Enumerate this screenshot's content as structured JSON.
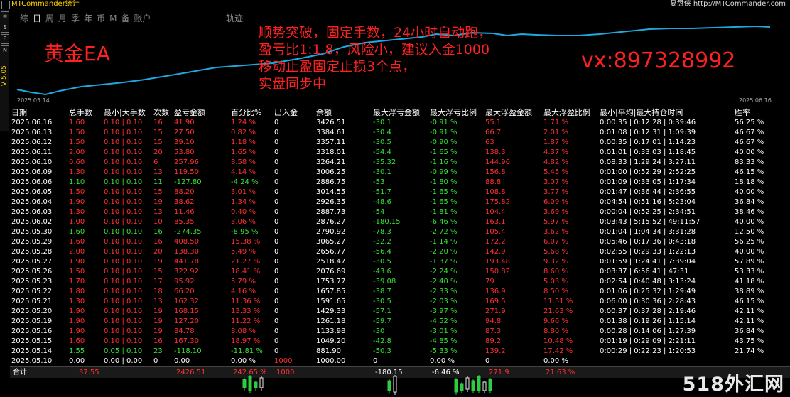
{
  "titlebar": {
    "title": "MTCommander统计",
    "right": "复盘侠 http://MTCommander.com"
  },
  "left_buttons": [
    "≡",
    "S",
    "E",
    "N"
  ],
  "version": "V 5.05",
  "tabs": [
    {
      "label": "综",
      "active": false
    },
    {
      "label": "日",
      "active": true
    },
    {
      "label": "周",
      "active": false
    },
    {
      "label": "月",
      "active": false
    },
    {
      "label": "季",
      "active": false
    },
    {
      "label": "年",
      "active": false
    },
    {
      "label": "币",
      "active": false
    },
    {
      "label": "M",
      "active": false
    },
    {
      "label": "备",
      "active": false
    },
    {
      "label": "账户",
      "active": false
    }
  ],
  "track_tab": "轨迹",
  "chart": {
    "date_start": "2025.05.14",
    "date_end": "2025.06.16",
    "line_color": "#1fa8e0"
  },
  "overlay": {
    "ea_title": "黄金EA",
    "lines": [
      "顺势突破，固定手数，24小时自动跑，",
      "盈亏比1:1.8，风险小，建议入金1000",
      "移动止盈固定止损3个点，",
      "实盘同步中"
    ],
    "contact": "vx:897328992"
  },
  "columns": [
    "日期",
    "总手数",
    "最小|大手数",
    "次数",
    "盈亏金额",
    "百分比%",
    "出入金",
    "余额",
    "最大浮亏金额",
    "最大浮亏比例",
    "最大浮盈金额",
    "最大浮盈比例",
    "最小|平均|最大持仓时间",
    "胜率"
  ],
  "rows": [
    {
      "date": "2025.06.16",
      "lots": "1.60",
      "minmax": "0.10 | 0.10",
      "count": "16",
      "pnl": "41.90",
      "pct": "1.24 %",
      "io": "0",
      "bal": "3426.51",
      "mfl": "-30.1",
      "mflp": "-0.91 %",
      "mfg": "55.1",
      "mfgp": "1.71 %",
      "time": "0:00:35 | 0:12:28 | 0:39:46",
      "win": "56.25 %",
      "color": "red"
    },
    {
      "date": "2025.06.13",
      "lots": "1.50",
      "minmax": "0.10 | 0.10",
      "count": "15",
      "pnl": "27.50",
      "pct": "0.82 %",
      "io": "0",
      "bal": "3384.61",
      "mfl": "-30.4",
      "mflp": "-0.91 %",
      "mfg": "66.7",
      "mfgp": "2.01 %",
      "time": "0:01:08 | 0:12:31 | 1:09:39",
      "win": "46.67 %",
      "color": "red"
    },
    {
      "date": "2025.06.12",
      "lots": "1.50",
      "minmax": "0.10 | 0.10",
      "count": "15",
      "pnl": "39.10",
      "pct": "1.18 %",
      "io": "0",
      "bal": "3357.11",
      "mfl": "-30.5",
      "mflp": "-0.90 %",
      "mfg": "63",
      "mfgp": "1.87 %",
      "time": "0:00:35 | 0:17:01 | 1:14:23",
      "win": "46.67 %",
      "color": "red"
    },
    {
      "date": "2025.06.11",
      "lots": "2.00",
      "minmax": "0.10 | 0.10",
      "count": "20",
      "pnl": "53.80",
      "pct": "1.65 %",
      "io": "0",
      "bal": "3318.01",
      "mfl": "-54.4",
      "mflp": "-1.65 %",
      "mfg": "138.3",
      "mfgp": "4.37 %",
      "time": "0:01:01 | 0:33:03 | 1:18:45",
      "win": "40.00 %",
      "color": "red"
    },
    {
      "date": "2025.06.10",
      "lots": "0.60",
      "minmax": "0.10 | 0.10",
      "count": "6",
      "pnl": "257.96",
      "pct": "8.58 %",
      "io": "0",
      "bal": "3264.21",
      "mfl": "-35.32",
      "mflp": "-1.16 %",
      "mfg": "144.96",
      "mfgp": "4.82 %",
      "time": "0:08:33 | 1:29:24 | 3:27:11",
      "win": "83.33 %",
      "color": "red"
    },
    {
      "date": "2025.06.09",
      "lots": "1.30",
      "minmax": "0.10 | 0.10",
      "count": "13",
      "pnl": "119.50",
      "pct": "4.14 %",
      "io": "0",
      "bal": "3006.25",
      "mfl": "-30.1",
      "mflp": "-0.99 %",
      "mfg": "156.8",
      "mfgp": "5.45 %",
      "time": "0:01:00 | 0:52:29 | 2:52:25",
      "win": "46.15 %",
      "color": "red"
    },
    {
      "date": "2025.06.06",
      "lots": "1.10",
      "minmax": "0.10 | 0.10",
      "count": "11",
      "pnl": "-127.80",
      "pct": "-4.24 %",
      "io": "0",
      "bal": "2886.75",
      "mfl": "-53",
      "mflp": "-1.80 %",
      "mfg": "88.8",
      "mfgp": "3.07 %",
      "time": "0:01:09 | 0:33:05 | 1:17:34",
      "win": "18.18 %",
      "color": "green"
    },
    {
      "date": "2025.06.05",
      "lots": "1.50",
      "minmax": "0.10 | 0.10",
      "count": "15",
      "pnl": "88.20",
      "pct": "3.01 %",
      "io": "0",
      "bal": "3014.55",
      "mfl": "-51.7",
      "mflp": "-1.65 %",
      "mfg": "108.8",
      "mfgp": "3.77 %",
      "time": "0:01:47 | 0:36:44 | 2:36:55",
      "win": "40.00 %",
      "color": "red"
    },
    {
      "date": "2025.06.04",
      "lots": "1.90",
      "minmax": "0.10 | 0.10",
      "count": "19",
      "pnl": "38.62",
      "pct": "1.34 %",
      "io": "0",
      "bal": "2926.35",
      "mfl": "-48.6",
      "mflp": "-1.65 %",
      "mfg": "175.82",
      "mfgp": "6.09 %",
      "time": "0:04:54 | 0:51:16 | 5:23:04",
      "win": "36.84 %",
      "color": "red"
    },
    {
      "date": "2025.06.03",
      "lots": "1.30",
      "minmax": "0.10 | 0.10",
      "count": "13",
      "pnl": "11.46",
      "pct": "0.40 %",
      "io": "0",
      "bal": "2887.73",
      "mfl": "-54",
      "mflp": "-1.81 %",
      "mfg": "104.4",
      "mfgp": "3.69 %",
      "time": "0:00:04 | 0:52:25 | 2:34:51",
      "win": "38.46 %",
      "color": "red"
    },
    {
      "date": "2025.06.02",
      "lots": "1.00",
      "minmax": "0.10 | 0.10",
      "count": "10",
      "pnl": "85.35",
      "pct": "3.06 %",
      "io": "0",
      "bal": "2876.27",
      "mfl": "-180.15",
      "mflp": "-6.46 %",
      "mfg": "163.1",
      "mfgp": "5.97 %",
      "time": "0:03:43 | 5:15:52 | 49:11:57",
      "win": "40.00 %",
      "color": "red"
    },
    {
      "date": "2025.05.30",
      "lots": "1.60",
      "minmax": "0.10 | 0.10",
      "count": "16",
      "pnl": "-274.35",
      "pct": "-8.95 %",
      "io": "0",
      "bal": "2790.92",
      "mfl": "-78.3",
      "mflp": "-2.72 %",
      "mfg": "105.4",
      "mfgp": "3.62 %",
      "time": "0:01:04 | 1:04:34 | 3:31:28",
      "win": "12.50 %",
      "color": "green"
    },
    {
      "date": "2025.05.29",
      "lots": "1.60",
      "minmax": "0.10 | 0.10",
      "count": "16",
      "pnl": "408.50",
      "pct": "15.38 %",
      "io": "0",
      "bal": "3065.27",
      "mfl": "-32.2",
      "mflp": "-1.14 %",
      "mfg": "172.2",
      "mfgp": "6.07 %",
      "time": "0:05:46 | 0:17:36 | 0:43:18",
      "win": "56.25 %",
      "color": "red"
    },
    {
      "date": "2025.05.28",
      "lots": "2.00",
      "minmax": "0.10 | 0.10",
      "count": "20",
      "pnl": "138.30",
      "pct": "5.49 %",
      "io": "0",
      "bal": "2656.77",
      "mfl": "-56.4",
      "mflp": "-2.20 %",
      "mfg": "142.9",
      "mfgp": "5.68 %",
      "time": "0:02:55 | 0:29:33 | 1:22:13",
      "win": "40.00 %",
      "color": "red"
    },
    {
      "date": "2025.05.27",
      "lots": "1.90",
      "minmax": "0.10 | 0.10",
      "count": "19",
      "pnl": "441.78",
      "pct": "21.27 %",
      "io": "0",
      "bal": "2518.47",
      "mfl": "-30.5",
      "mflp": "-1.37 %",
      "mfg": "193.48",
      "mfgp": "9.32 %",
      "time": "0:01:59 | 1:24:41 | 7:39:04",
      "win": "57.89 %",
      "color": "red"
    },
    {
      "date": "2025.05.26",
      "lots": "1.50",
      "minmax": "0.10 | 0.10",
      "count": "15",
      "pnl": "322.92",
      "pct": "18.41 %",
      "io": "0",
      "bal": "2076.69",
      "mfl": "-43.6",
      "mflp": "-2.24 %",
      "mfg": "150.82",
      "mfgp": "8.60 %",
      "time": "0:03:37 | 6:56:41 | 47:31",
      "win": "53.33 %",
      "color": "red"
    },
    {
      "date": "2025.05.23",
      "lots": "1.70",
      "minmax": "0.10 | 0.10",
      "count": "17",
      "pnl": "95.92",
      "pct": "5.79 %",
      "io": "0",
      "bal": "1753.77",
      "mfl": "-39.08",
      "mflp": "-2.40 %",
      "mfg": "79",
      "mfgp": "5.03 %",
      "time": "0:02:54 | 0:40:48 | 3:13:24",
      "win": "41.18 %",
      "color": "red"
    },
    {
      "date": "2025.05.22",
      "lots": "1.80",
      "minmax": "0.10 | 0.10",
      "count": "18",
      "pnl": "66.20",
      "pct": "4.16 %",
      "io": "0",
      "bal": "1657.85",
      "mfl": "-38.7",
      "mflp": "-2.33 %",
      "mfg": "136.9",
      "mfgp": "8.50 %",
      "time": "0:01:06 | 0:25:32 | 1:29:49",
      "win": "38.89 %",
      "color": "red"
    },
    {
      "date": "2025.05.21",
      "lots": "1.30",
      "minmax": "0.10 | 0.10",
      "count": "13",
      "pnl": "162.32",
      "pct": "11.36 %",
      "io": "0",
      "bal": "1591.65",
      "mfl": "-30.5",
      "mflp": "-2.03 %",
      "mfg": "169.5",
      "mfgp": "11.51 %",
      "time": "0:06:00 | 0:30:36 | 2:28:43",
      "win": "46.15 %",
      "color": "red"
    },
    {
      "date": "2025.05.20",
      "lots": "1.90",
      "minmax": "0.10 | 0.10",
      "count": "19",
      "pnl": "168.15",
      "pct": "13.33 %",
      "io": "0",
      "bal": "1429.33",
      "mfl": "-57.1",
      "mflp": "-3.97 %",
      "mfg": "271.9",
      "mfgp": "21.63 %",
      "time": "0:00:37 | 0:37:28 | 2:19:46",
      "win": "42.11 %",
      "color": "red"
    },
    {
      "date": "2025.05.19",
      "lots": "1.90",
      "minmax": "0.10 | 0.10",
      "count": "19",
      "pnl": "127.20",
      "pct": "11.22 %",
      "io": "0",
      "bal": "1261.18",
      "mfl": "-59.7",
      "mflp": "-4.52 %",
      "mfg": "94.8",
      "mfgp": "9.66 %",
      "time": "0:01:38 | 0:19:26 | 1:15:14",
      "win": "42.11 %",
      "color": "red"
    },
    {
      "date": "2025.05.16",
      "lots": "1.90",
      "minmax": "0.10 | 0.10",
      "count": "19",
      "pnl": "84.78",
      "pct": "8.08 %",
      "io": "0",
      "bal": "1133.98",
      "mfl": "-30",
      "mflp": "-3.01 %",
      "mfg": "87.3",
      "mfgp": "8.80 %",
      "time": "0:00:28 | 0:14:06 | 1:27:39",
      "win": "36.84 %",
      "color": "red"
    },
    {
      "date": "2025.05.15",
      "lots": "1.60",
      "minmax": "0.10 | 0.10",
      "count": "16",
      "pnl": "167.30",
      "pct": "18.97 %",
      "io": "0",
      "bal": "1049.20",
      "mfl": "-42.8",
      "mflp": "-4.85 %",
      "mfg": "89.2",
      "mfgp": "10.48 %",
      "time": "0:01:19 | 0:29:09 | 2:21:11",
      "win": "43.75 %",
      "color": "red"
    },
    {
      "date": "2025.05.14",
      "lots": "1.55",
      "minmax": "0.05 | 0.10",
      "count": "23",
      "pnl": "-118.10",
      "pct": "-11.81 %",
      "io": "0",
      "bal": "881.90",
      "mfl": "-50.3",
      "mflp": "-5.33 %",
      "mfg": "139.2",
      "mfgp": "17.42 %",
      "time": "0:00:29 | 0:22:23 | 1:20:53",
      "win": "21.74 %",
      "color": "green"
    },
    {
      "date": "2025.05.10",
      "lots": "0.00",
      "minmax": "0.00 | 0.00",
      "count": "0",
      "pnl": "0.00",
      "pct": "0.00 %",
      "io": "1000",
      "bal": "1000.00",
      "mfl": "0",
      "mflp": "0.00 %",
      "mfg": "0",
      "mfgp": "0.00 %",
      "time": "",
      "win": "",
      "color": "white"
    }
  ],
  "total": {
    "label": "合计",
    "lots": "37.55",
    "pnl": "2426.51",
    "pct": "242.65 %",
    "io": "1000",
    "mfl": "-180.15",
    "mflp": "-6.46 %",
    "mfg": "271.9",
    "mfgp": "21.63 %"
  },
  "watermark": "518外汇网"
}
